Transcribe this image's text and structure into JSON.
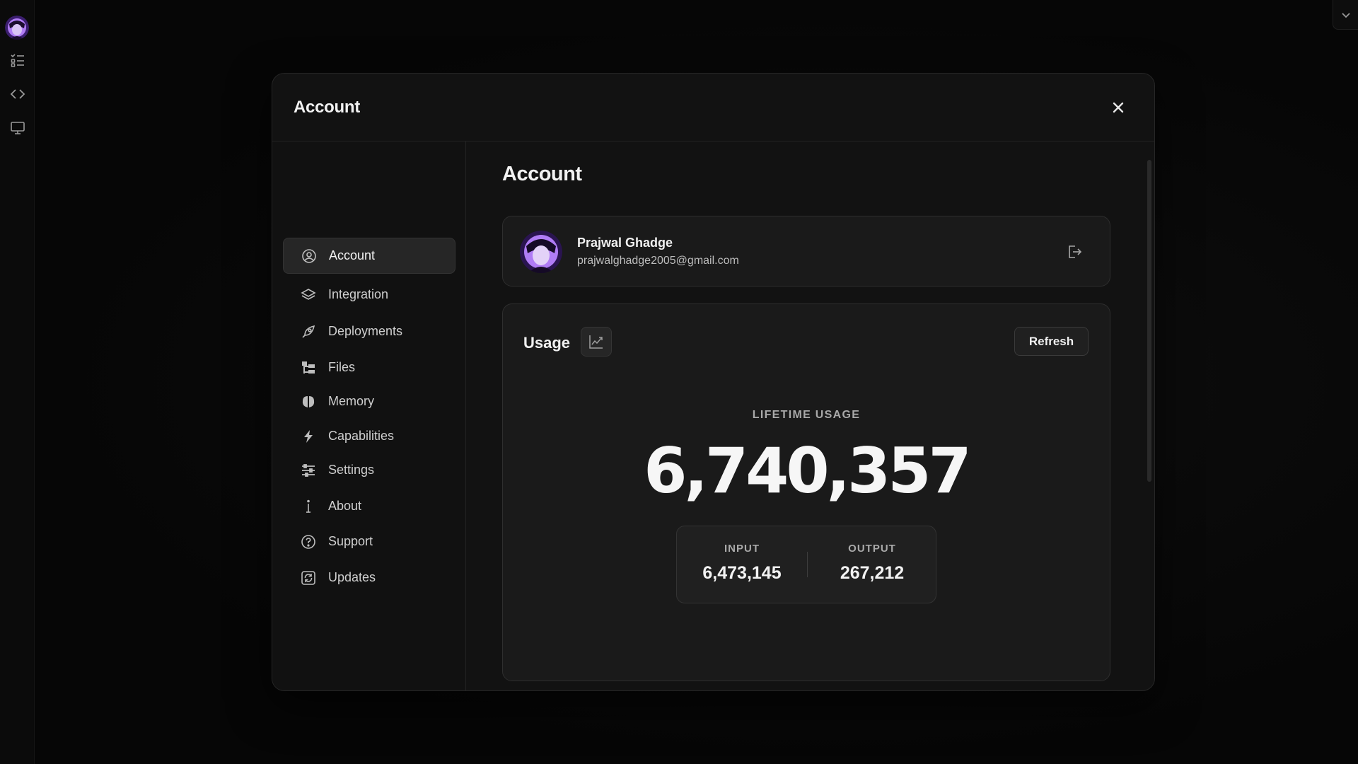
{
  "rail": {
    "items": [
      {
        "name": "tasks-icon"
      },
      {
        "name": "code-icon"
      },
      {
        "name": "monitor-icon"
      }
    ]
  },
  "modal": {
    "title": "Account",
    "close_icon": "close-icon"
  },
  "nav": {
    "items": [
      {
        "label": "Account",
        "icon": "user-circle-icon",
        "active": true
      },
      {
        "label": "Integration",
        "icon": "layers-icon",
        "active": false
      },
      {
        "label": "Deployments",
        "icon": "rocket-icon",
        "active": false
      },
      {
        "label": "Files",
        "icon": "folder-tree-icon",
        "active": false
      },
      {
        "label": "Memory",
        "icon": "brain-icon",
        "active": false
      },
      {
        "label": "Capabilities",
        "icon": "lightning-icon",
        "active": false
      },
      {
        "label": "Settings",
        "icon": "sliders-icon",
        "active": false
      },
      {
        "label": "About",
        "icon": "info-icon",
        "active": false
      },
      {
        "label": "Support",
        "icon": "help-circle-icon",
        "active": false
      },
      {
        "label": "Updates",
        "icon": "refresh-icon",
        "active": false
      }
    ]
  },
  "content": {
    "title": "Account",
    "profile": {
      "name": "Prajwal Ghadge",
      "email": "prajwalghadge2005@gmail.com"
    },
    "usage": {
      "title": "Usage",
      "refresh_label": "Refresh",
      "lifetime_label": "LIFETIME USAGE",
      "lifetime_value": "6,740,357",
      "input_label": "INPUT",
      "input_value": "6,473,145",
      "output_label": "OUTPUT",
      "output_value": "267,212"
    }
  },
  "colors": {
    "background": "#050505",
    "panel": "#121212",
    "card": "#1a1a1a",
    "active_nav": "#262626",
    "avatar_accent": "#a66cf0"
  }
}
